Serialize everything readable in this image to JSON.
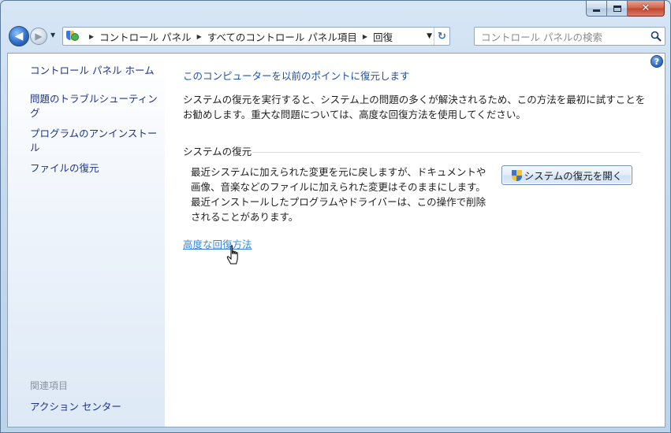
{
  "window": {
    "caption": {
      "minimize": "—",
      "maximize": "□",
      "close": "✕"
    }
  },
  "navbar": {
    "breadcrumbs": [
      "コントロール パネル",
      "すべてのコントロール パネル項目",
      "回復"
    ],
    "search_placeholder": "コントロール パネルの検索"
  },
  "sidebar": {
    "home": "コントロール パネル ホーム",
    "links": [
      "問題のトラブルシューティング",
      "プログラムのアンインストール",
      "ファイルの復元"
    ],
    "related_heading": "関連項目",
    "related_links": [
      "アクション センター"
    ]
  },
  "main": {
    "title": "このコンピューターを以前のポイントに復元します",
    "description": "システムの復元を実行すると、システム上の問題の多くが解決されるため、この方法を最初に試すことをお勧めします。重大な問題については、高度な回復方法を使用してください。",
    "group_label": "システムの復元",
    "restore_description": "最近システムに加えられた変更を元に戻しますが、ドキュメントや画像、音楽などのファイルに加えられた変更はそのままにします。最近インストールしたプログラムやドライバーは、この操作で削除されることがあります。",
    "restore_button": "システムの復元を開く",
    "advanced_link": "高度な回復方法",
    "help": "?"
  },
  "colors": {
    "link": "#1e3287",
    "title": "#1b51a8",
    "hover_link": "#3a87d9"
  }
}
